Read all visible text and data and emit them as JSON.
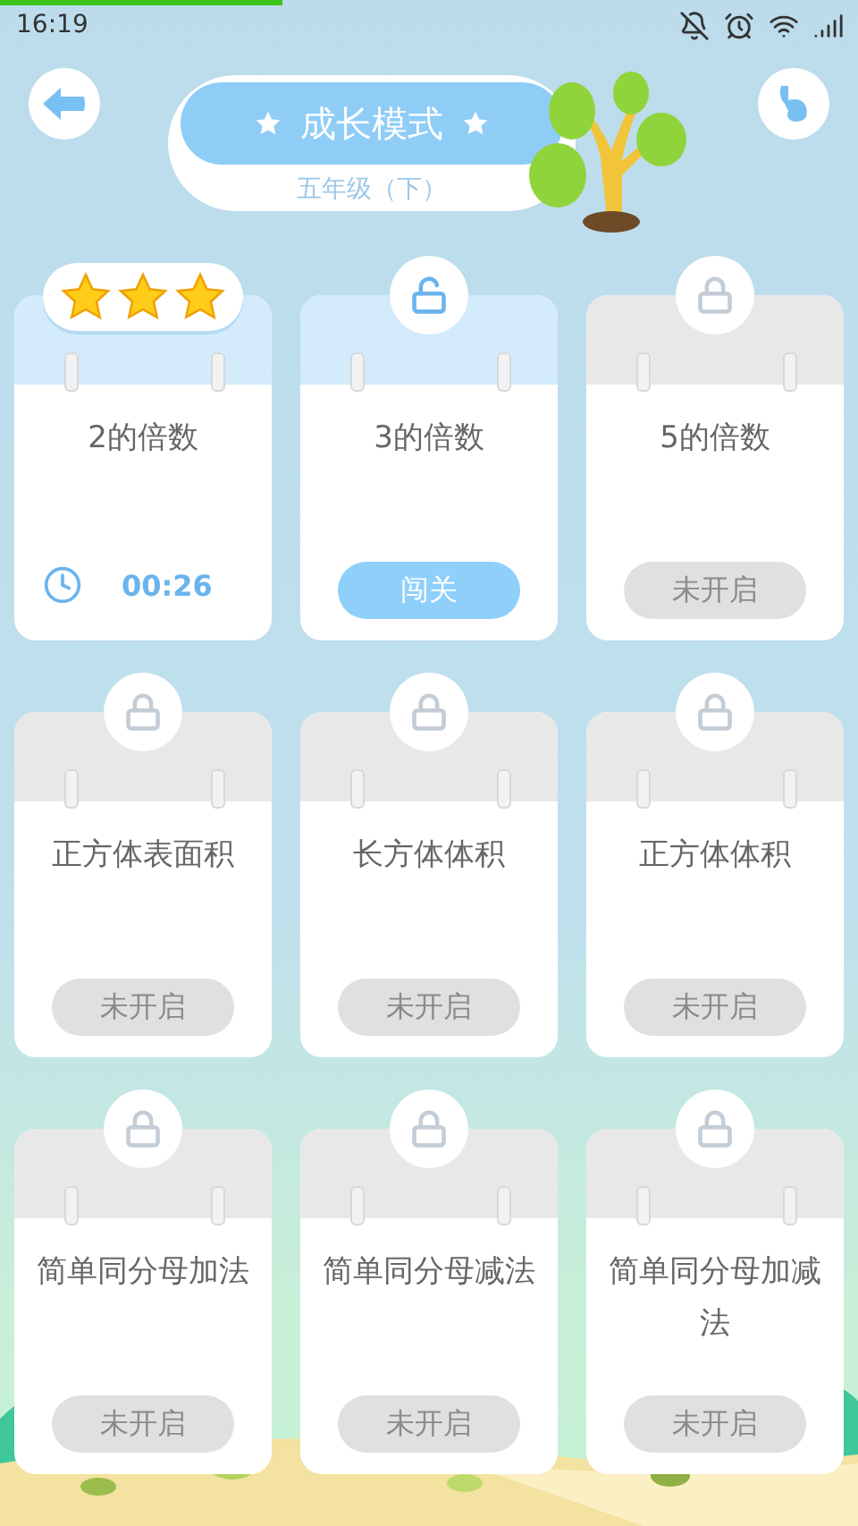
{
  "status_bar": {
    "time": "16:19"
  },
  "header": {
    "title": "成长模式",
    "subtitle": "五年级（下）"
  },
  "levels": [
    {
      "kind": "completed",
      "title": "2的倍数",
      "stars": 3,
      "time": "00:26"
    },
    {
      "kind": "open",
      "title": "3的倍数",
      "action": "闯关"
    },
    {
      "kind": "locked",
      "title": "5的倍数",
      "action": "未开启"
    },
    {
      "kind": "locked",
      "title": "正方体表面积",
      "action": "未开启"
    },
    {
      "kind": "locked",
      "title": "长方体体积",
      "action": "未开启"
    },
    {
      "kind": "locked",
      "title": "正方体体积",
      "action": "未开启"
    },
    {
      "kind": "locked",
      "title": "简单同分母加法",
      "action": "未开启"
    },
    {
      "kind": "locked",
      "title": "简单同分母减法",
      "action": "未开启"
    },
    {
      "kind": "locked",
      "title": "简单同分母加减法",
      "action": "未开启"
    }
  ]
}
